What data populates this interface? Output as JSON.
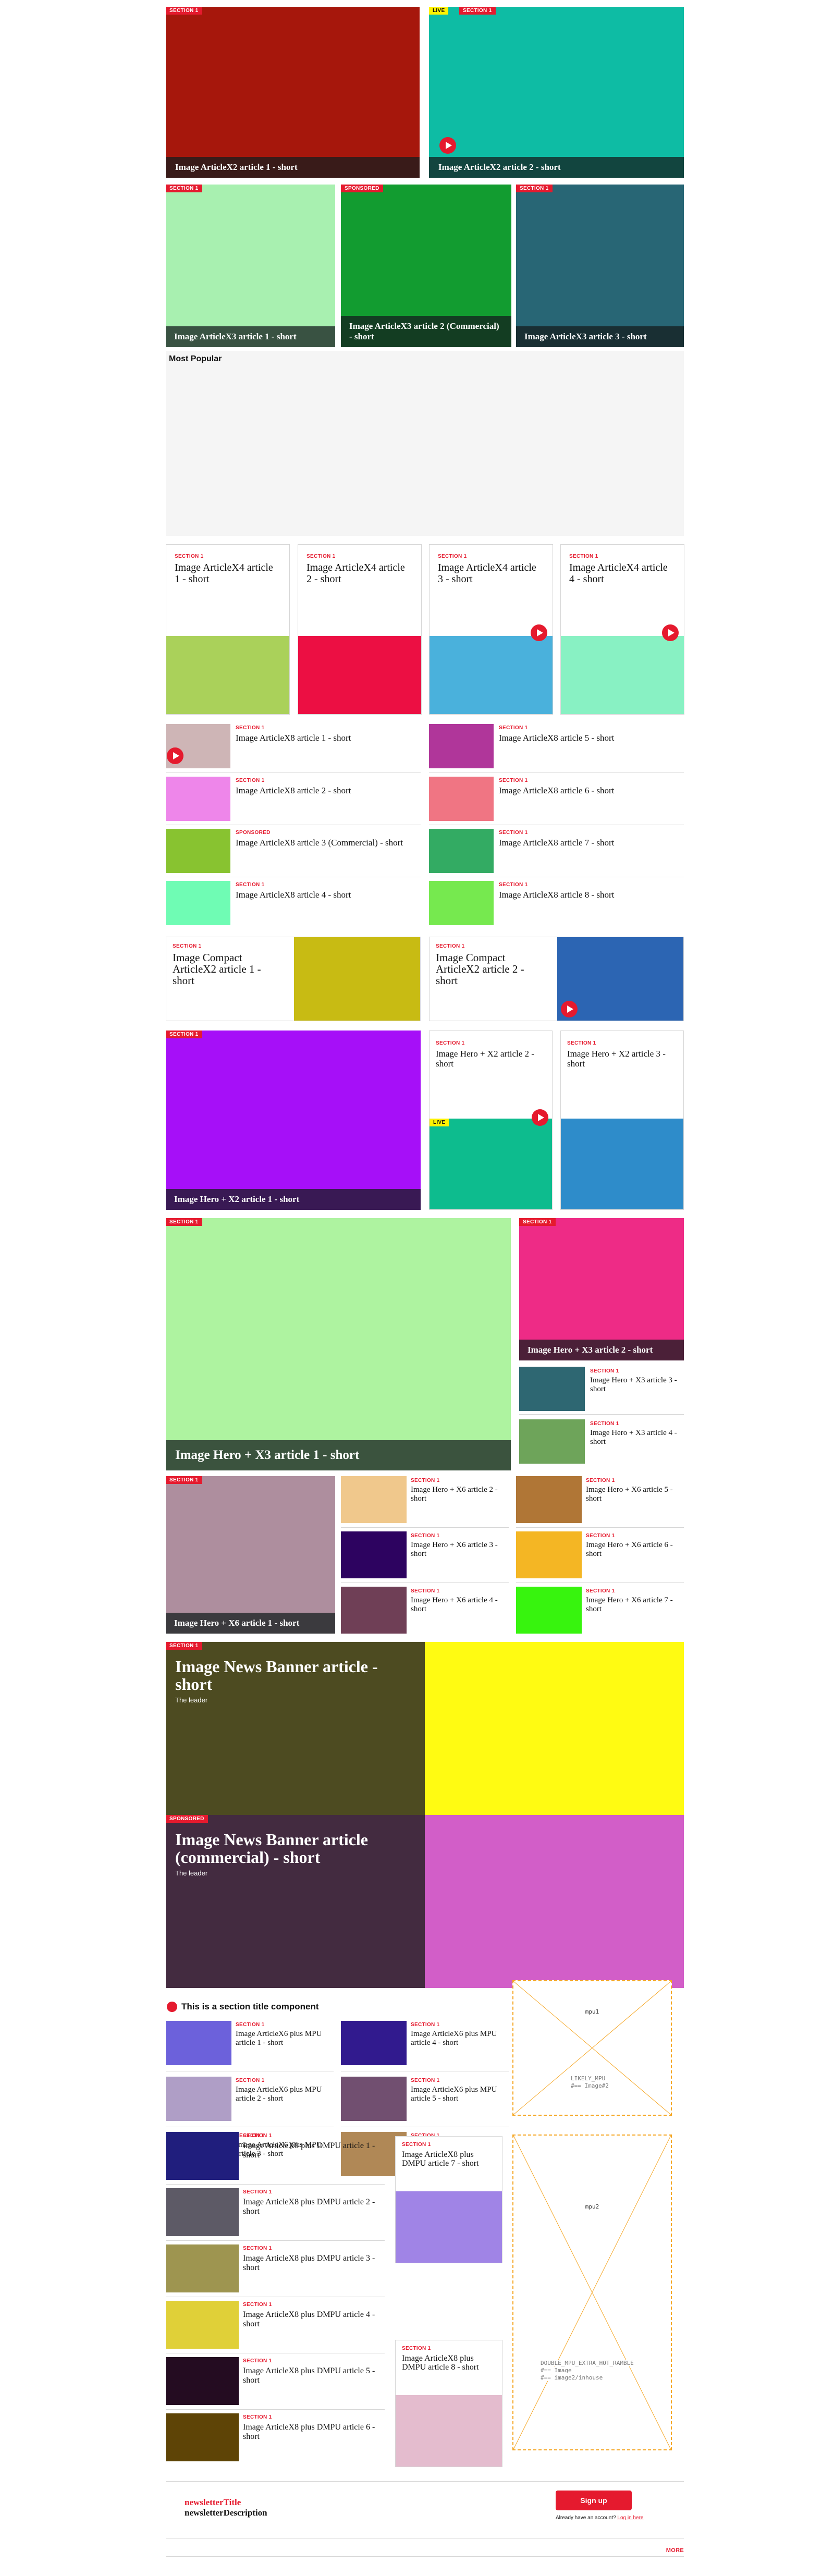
{
  "colors": {
    "accent": "#e51a2e",
    "live": "#fff200",
    "border": "#d6d6d6"
  },
  "x2": [
    {
      "title": "Image ArticleX2 article 1 - short",
      "section": "SECTION 1",
      "color": "#a6170c",
      "video": false,
      "live": false
    },
    {
      "title": "Image ArticleX2 article 2 - short",
      "section": "SECTION 1",
      "live_label": "LIVE",
      "color": "#0ebca4",
      "video": true,
      "live": true
    }
  ],
  "x3": [
    {
      "title": "Image ArticleX3 article 1 - short",
      "section": "SECTION 1",
      "color": "#a8f0b0"
    },
    {
      "title": "Image ArticleX3 article 2 (Commercial) - short",
      "section": "SPONSORED",
      "color": "#129c30"
    },
    {
      "title": "Image ArticleX3 article 3 - short",
      "section": "SECTION 1",
      "color": "#286675"
    }
  ],
  "most_popular": {
    "title": "Most Popular"
  },
  "x4": [
    {
      "title": "Image ArticleX4 article 1 - short",
      "section": "SECTION 1",
      "color": "#aad15a",
      "video": false
    },
    {
      "title": "Image ArticleX4 article 2 - short",
      "section": "SECTION 1",
      "color": "#ec0f43",
      "video": false
    },
    {
      "title": "Image ArticleX4 article 3 - short",
      "section": "SECTION 1",
      "color": "#4ab1dc",
      "video": true
    },
    {
      "title": "Image ArticleX4 article 4 - short",
      "section": "SECTION 1",
      "color": "#88f1c3",
      "video": true
    }
  ],
  "x8": [
    {
      "title": "Image ArticleX8 article 1 - short",
      "section": "SECTION 1",
      "color": "#ceb5b6",
      "video": true
    },
    {
      "title": "Image ArticleX8 article 2 - short",
      "section": "SECTION 1",
      "color": "#ee86ea",
      "video": false
    },
    {
      "title": "Image ArticleX8 article 3 (Commercial) - short",
      "section": "SPONSORED",
      "color": "#88c330",
      "video": false
    },
    {
      "title": "Image ArticleX8 article 4 - short",
      "section": "SECTION 1",
      "color": "#6ffcb4",
      "video": false
    },
    {
      "title": "Image ArticleX8 article 5 - short",
      "section": "SECTION 1",
      "color": "#b0369a",
      "video": false
    },
    {
      "title": "Image ArticleX8 article 6 - short",
      "section": "SECTION 1",
      "color": "#f07583",
      "video": false
    },
    {
      "title": "Image ArticleX8 article 7 - short",
      "section": "SECTION 1",
      "color": "#33ab63",
      "video": false
    },
    {
      "title": "Image ArticleX8 article 8 - short",
      "section": "SECTION 1",
      "color": "#76e94f",
      "video": false
    }
  ],
  "compact": [
    {
      "title": "Image Compact ArticleX2 article 1 - short",
      "section": "SECTION 1",
      "color": "#c8bb13",
      "video": false
    },
    {
      "title": "Image Compact ArticleX2 article 2 - short",
      "section": "SECTION 1",
      "color": "#2c65b3",
      "video": true
    }
  ],
  "hero_x2": [
    {
      "title": "Image Hero + X2 article 1 - short",
      "section": "SECTION 1",
      "color": "#a60ff8"
    },
    {
      "title": "Image Hero + X2 article 2 - short",
      "section": "SECTION 1",
      "live_label": "LIVE",
      "color": "#0dbc8e",
      "video": true
    },
    {
      "title": "Image Hero + X2 article 3 - short",
      "section": "SECTION 1",
      "color": "#2e8cca"
    }
  ],
  "hero_x3": [
    {
      "title": "Image Hero + X3 article 1 - short",
      "section": "SECTION 1",
      "color": "#aef3a0"
    },
    {
      "title": "Image Hero + X3 article 2 - short",
      "section": "SECTION 1",
      "color": "#ee2b86"
    },
    {
      "title": "Image Hero + X3 article 3 - short",
      "section": "SECTION 1",
      "color": "#2e6772"
    },
    {
      "title": "Image Hero + X3 article 4 - short",
      "section": "SECTION 1",
      "color": "#6ea45a"
    }
  ],
  "hero_x6": [
    {
      "title": "Image Hero + X6 article 1 - short",
      "section": "SECTION 1",
      "color": "#ae8e9e"
    },
    {
      "title": "Image Hero + X6 article 2 - short",
      "section": "SECTION 1",
      "color": "#f0c88c"
    },
    {
      "title": "Image Hero + X6 article 3 - short",
      "section": "SECTION 1",
      "color": "#2d0360"
    },
    {
      "title": "Image Hero + X6 article 4 - short",
      "section": "SECTION 1",
      "color": "#6f3f56"
    },
    {
      "title": "Image Hero + X6 article 5 - short",
      "section": "SECTION 1",
      "color": "#b07636"
    },
    {
      "title": "Image Hero + X6 article 6 - short",
      "section": "SECTION 1",
      "color": "#f4b624"
    },
    {
      "title": "Image Hero + X6 article 7 - short",
      "section": "SECTION 1",
      "color": "#37f40e"
    }
  ],
  "banners": [
    {
      "title": "Image News Banner article - short",
      "section": "SECTION 1",
      "subtitle": "The leader",
      "bg": "#4d4b21",
      "color": "#fffb12"
    },
    {
      "title": "Image News Banner article (commercial) - short",
      "section": "SPONSORED",
      "subtitle": "The leader",
      "bg": "#432b40",
      "color": "#d25ec8"
    }
  ],
  "section_title": "This is a section title component",
  "x6_mpu": [
    {
      "title": "Image ArticleX6 plus MPU article 1 - short",
      "section": "SECTION 1",
      "color": "#6c61db"
    },
    {
      "title": "Image ArticleX6 plus MPU article 2 - short",
      "section": "SECTION 1",
      "color": "#af9ec6"
    },
    {
      "title": "Image ArticleX6 plus MPU article 3 - short",
      "section": "SECTION 1",
      "color": "#efd9a4"
    },
    {
      "title": "Image ArticleX6 plus MPU article 4 - short",
      "section": "SECTION 1",
      "color": "#311a8e"
    },
    {
      "title": "Image ArticleX6 plus MPU article 5 - short",
      "section": "SECTION 1",
      "color": "#714f70"
    },
    {
      "title": "Image ArticleX6 plus MPU article 6 - short",
      "section": "SECTION 1",
      "color": "#b08856"
    }
  ],
  "mpu1": {
    "label": "mpu1",
    "line1": "LIKELY_MPU",
    "line2": "#== Image#2"
  },
  "x8_dmpu": [
    {
      "title": "Image ArticleX8 plus DMPU article 1 - short",
      "section": "SECTION 1",
      "color": "#201e7d"
    },
    {
      "title": "Image ArticleX8 plus DMPU article 2 - short",
      "section": "SECTION 1",
      "color": "#5d5a66"
    },
    {
      "title": "Image ArticleX8 plus DMPU article 3 - short",
      "section": "SECTION 1",
      "color": "#9e9550"
    },
    {
      "title": "Image ArticleX8 plus DMPU article 4 - short",
      "section": "SECTION 1",
      "color": "#e0d038"
    },
    {
      "title": "Image ArticleX8 plus DMPU article 5 - short",
      "section": "SECTION 1",
      "color": "#240c21"
    },
    {
      "title": "Image ArticleX8 plus DMPU article 6 - short",
      "section": "SECTION 1",
      "color": "#5e4406"
    },
    {
      "title": "Image ArticleX8 plus DMPU article 7 - short",
      "section": "SECTION 1",
      "color": "#a084e6"
    },
    {
      "title": "Image ArticleX8 plus DMPU article 8 - short",
      "section": "SECTION 1",
      "color": "#e4bcce"
    }
  ],
  "mpu2": {
    "label": "mpu2",
    "line1": "DOUBLE_MPU_EXTRA_HOT_RAMBLE",
    "line2": "#== Image",
    "line3": "#== image2/inhouse"
  },
  "newsletter": {
    "title": "newsletterTitle",
    "description": "newsletterDescription",
    "signup": "Sign up",
    "account_prompt": "Already have an account?",
    "login": "Log in here"
  },
  "more": "MORE"
}
